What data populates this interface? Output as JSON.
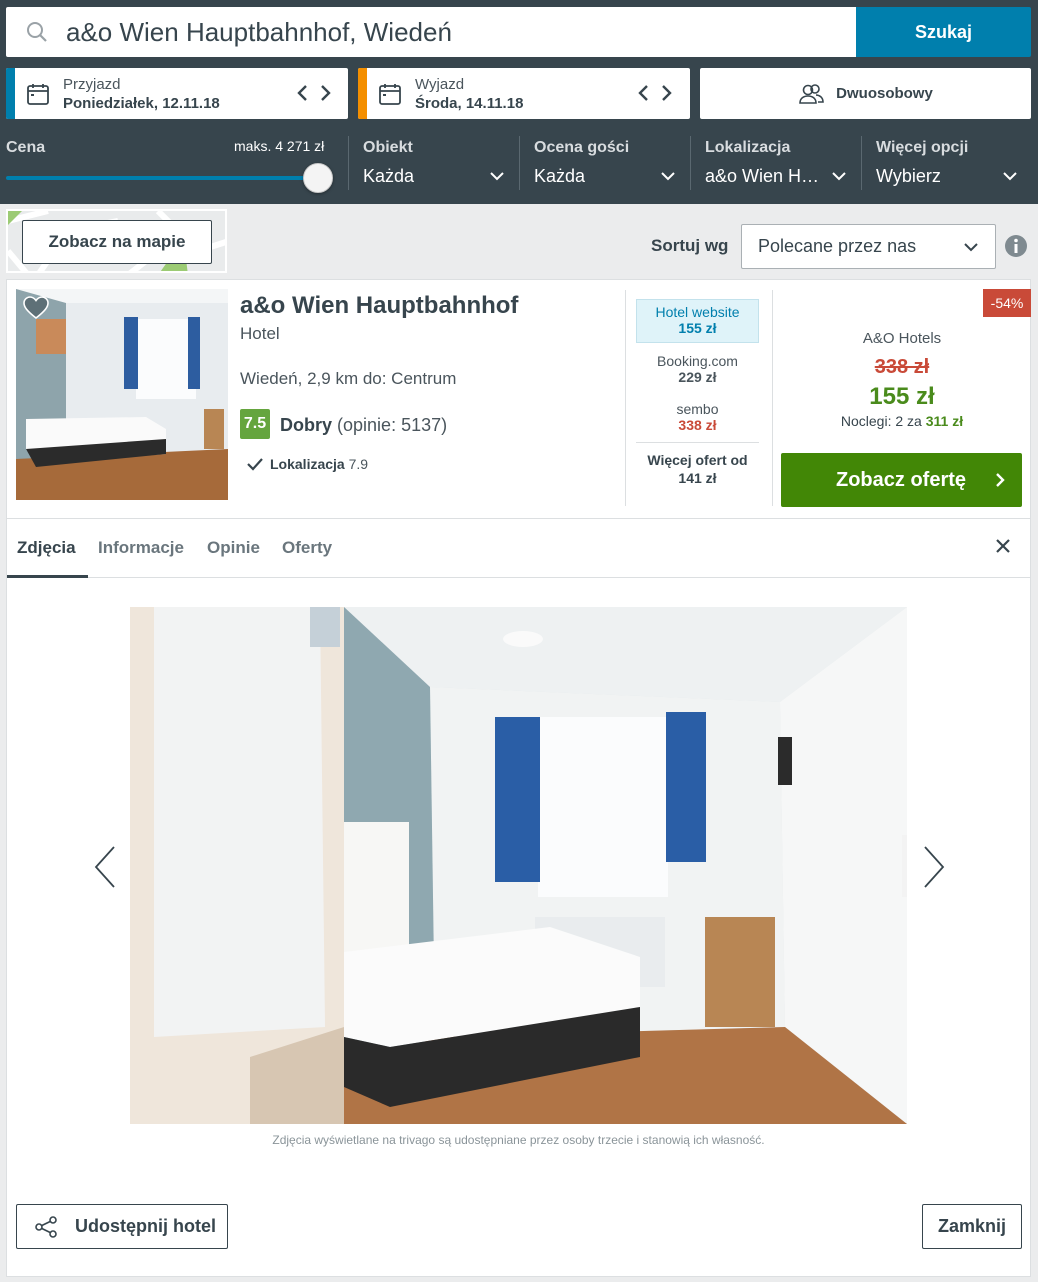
{
  "search": {
    "value": "a&o Wien Hauptbahnhof, Wiedeń",
    "button": "Szukaj"
  },
  "checkin": {
    "label": "Przyjazd",
    "value": "Poniedziałek, 12.11.18",
    "accent": "#007fad"
  },
  "checkout": {
    "label": "Wyjazd",
    "value": "Środa, 14.11.18",
    "accent": "#f48f00"
  },
  "room": {
    "label": "Dwuosobowy"
  },
  "filters": {
    "price": {
      "title": "Cena",
      "max_label": "maks. 4 271 zł",
      "slider_level": 1.0
    },
    "property": {
      "title": "Obiekt",
      "value": "Każda"
    },
    "guest_rating": {
      "title": "Ocena gości",
      "value": "Każda"
    },
    "location": {
      "title": "Lokalizacja",
      "value": "a&o Wien H…"
    },
    "more": {
      "title": "Więcej opcji",
      "value": "Wybierz"
    }
  },
  "map_button": "Zobacz na mapie",
  "sort": {
    "label": "Sortuj wg",
    "value": "Polecane przez nas"
  },
  "hotel": {
    "name": "a&o Wien Hauptbahnhof",
    "type": "Hotel",
    "location": "Wiedeń, 2,9 km do: Centrum",
    "rating_score": "7.5",
    "rating_word": "Dobry",
    "rating_count": "(opinie: 5137)",
    "loc_label": "Lokalizacja",
    "loc_value": "7.9",
    "offers": [
      {
        "name": "Hotel website",
        "price": "155 zł"
      },
      {
        "name": "Booking.com",
        "price": "229 zł"
      },
      {
        "name": "sembo",
        "price": "338 zł"
      }
    ],
    "more_offers_line1": "Więcej ofert od",
    "more_offers_line2": "141 zł",
    "discount": "-54%",
    "partner": "A&O Hotels",
    "old_price": "338 zł",
    "new_price": "155 zł",
    "nights_text": "Noclegi: 2 za",
    "nights_total": "311 zł",
    "deal_button": "Zobacz ofertę"
  },
  "tabs": [
    "Zdjęcia",
    "Informacje",
    "Opinie",
    "Oferty"
  ],
  "caption": "Zdjęcia wyświetlane na trivago są udostępniane przez osoby trzecie i stanowią ich własność.",
  "share_button": "Udostępnij hotel",
  "close_button": "Zamknij",
  "colors": {
    "header_bg": "#37454d",
    "search_blue": "#007fad",
    "deal_green": "#428706",
    "price_red": "#c94a38",
    "rating_green": "#65a53e"
  }
}
